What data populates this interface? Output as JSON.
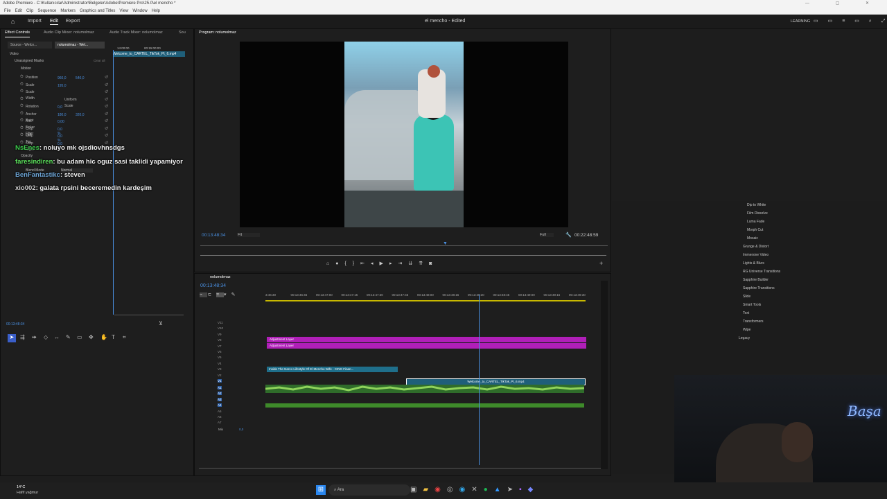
{
  "window": {
    "title": "Adobe Premiere - C:\\Kullanıcılar\\Administrator\\Belgeler\\Adobe\\Premiere Pro\\25.0\\el mencho *"
  },
  "menu": [
    "File",
    "Edit",
    "Clip",
    "Sequence",
    "Markers",
    "Graphics and Titles",
    "View",
    "Window",
    "Help"
  ],
  "header": {
    "import": "Import",
    "edit": "Edit",
    "export": "Export",
    "project_title": "el mencho",
    "status": "- Edited",
    "learning": "LEARNING"
  },
  "left_tabs": [
    "Effect Controls",
    "Audio Clip Mixer: nolumolmaz",
    "Audio Track Mixer: nolumolmaz",
    "Sou"
  ],
  "ec": {
    "source": "Source - Welco...",
    "seq": "nolumolmaz - Wel...",
    "ruler": [
      "14:00:00",
      "00:15:00:00"
    ],
    "clip": "Welcome_to_CARTEL_TikTok_Pt_6.mp4",
    "video": "Video",
    "masks": "Unassigned Masks",
    "clearall": "Clear all",
    "motion": "Motion",
    "props": [
      {
        "name": "Position",
        "v1": "960,0",
        "v2": "540,0"
      },
      {
        "name": "Scale",
        "v1": "195,0",
        "v2": ""
      },
      {
        "name": "Scale Width",
        "v1": "",
        "v2": ""
      },
      {
        "name": "Uniform Scale",
        "v1": "",
        "v2": ""
      },
      {
        "name": "Rotation",
        "v1": "0,0",
        "v2": ""
      },
      {
        "name": "Anchor Point",
        "v1": "180,0",
        "v2": "320,0"
      },
      {
        "name": "Anti-flicker Filter",
        "v1": "0,00",
        "v2": ""
      },
      {
        "name": "Crop Left",
        "v1": "0,0 %",
        "v2": ""
      },
      {
        "name": "Crop Top",
        "v1": "0,0 %",
        "v2": ""
      },
      {
        "name": "Crop Right",
        "v1": "0,0 %",
        "v2": ""
      }
    ],
    "opacity": "Opacity",
    "blend": "Blend Mode",
    "blend_val": "Normal",
    "timecode": "00:13:48:34"
  },
  "chat": [
    {
      "user": "NsEnes",
      "msg": "noluyo mk ojsdiovhnsdgs",
      "color": "#3fd24f"
    },
    {
      "user": "faresindiren",
      "msg": "bu adam hic oguz sasi taklidi yapamiyor",
      "color": "#5ee35e"
    },
    {
      "user": "BenFantastikc",
      "msg": "steven",
      "color": "#6fa7d8"
    },
    {
      "user": "xio002",
      "msg": "galata rpsini beceremedin kardeşim",
      "color": "#d0d0d0"
    }
  ],
  "program": {
    "tab": "Program: nolumolmaz",
    "timecode": "00:13:48:34",
    "fit": "Fit",
    "full": "Full",
    "duration": "00:22:48:59"
  },
  "timeline": {
    "tab": "nolumolmaz",
    "timecode": "00:13:48:34",
    "ruler": [
      "3:46:30",
      "00:13:46:45",
      "00:13:47:00",
      "00:13:47:15",
      "00:13:47:30",
      "00:13:47:45",
      "00:13:48:00",
      "00:13:48:15",
      "00:13:48:30",
      "00:13:48:45",
      "00:13:49:00",
      "00:13:49:15",
      "00:13:49:30"
    ],
    "vtracks": [
      "V11",
      "V10",
      "V9",
      "V8",
      "V7",
      "V6",
      "V5",
      "V4",
      "V3",
      "V2",
      "V1"
    ],
    "atracks": [
      "A1",
      "A2",
      "A3",
      "A4",
      "A5",
      "A6",
      "A7"
    ],
    "mix": "Mix",
    "mixval": "0,0",
    "adj1": "Adjustment Layer",
    "adj2": "Adjustment Layer",
    "clip_v3": "Inside The Narco Lifestyle Of El Mencho Wife - CING Finan...",
    "clip_v1": "Welcome_to_CARTEL_TikTok_Pt_6.mp4"
  },
  "effects": {
    "items": [
      "Dip to White",
      "Film Dissolve",
      "Luma Fade",
      "Morph Cut",
      "Mosaic"
    ],
    "folders": [
      "Grunge & Distort",
      "Immersive Video",
      "Lights & Blurs",
      "RG Universe Transitions",
      "Sapphire Builder",
      "Sapphire Transitions",
      "Slide",
      "Smart Tools",
      "Text",
      "Transformers",
      "Wipe",
      "Legacy"
    ]
  },
  "taskbar": {
    "temp": "14°C",
    "weather": "Hafif yağmur",
    "search": "Ara"
  },
  "neon": "Başa"
}
